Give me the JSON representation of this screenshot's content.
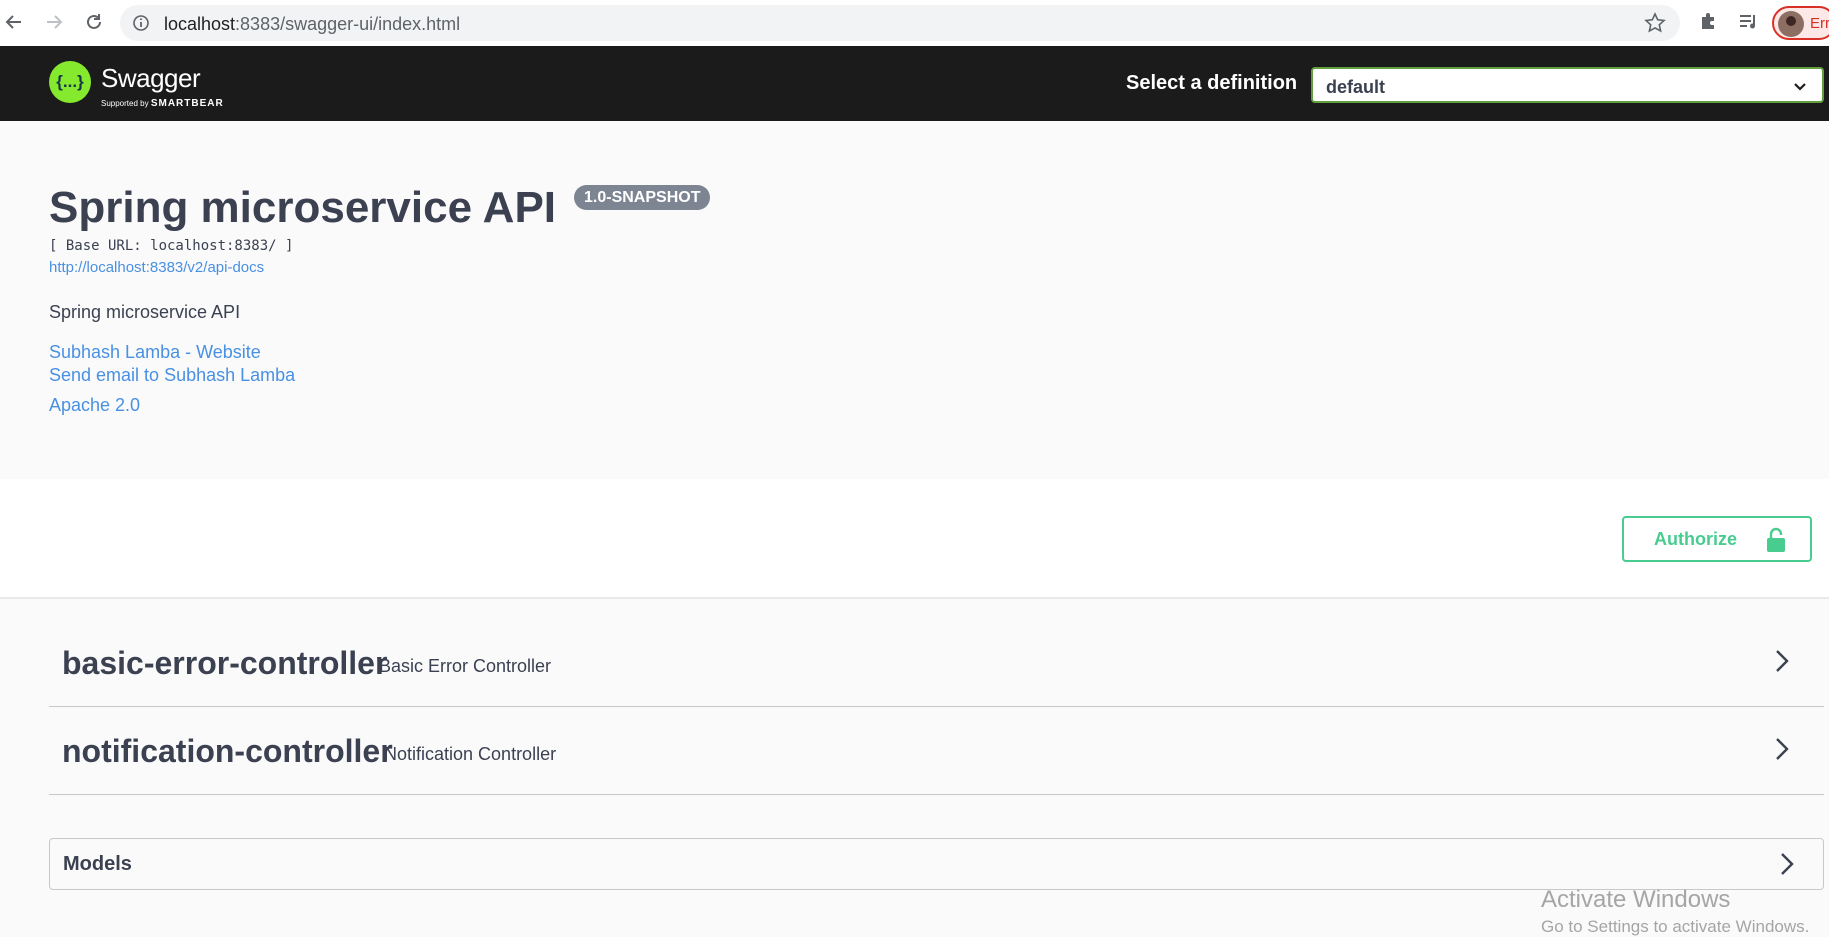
{
  "browser": {
    "url_host": "localhost",
    "url_rest": ":8383/swagger-ui/index.html",
    "profile_label": "Err"
  },
  "topbar": {
    "logo_symbol": "{...}",
    "logo_text": "Swagger",
    "logo_sub_prefix": "Supported by",
    "logo_sub_brand": "SMARTBEAR",
    "definition_label": "Select a definition",
    "definition_value": "default"
  },
  "info": {
    "title": "Spring microservice API",
    "version": "1.0-SNAPSHOT",
    "base_url": "[ Base URL: localhost:8383/ ]",
    "api_docs_link": "http://localhost:8383/v2/api-docs",
    "description": "Spring microservice API",
    "contact_website": "Subhash Lamba - Website",
    "contact_email": "Send email to Subhash Lamba",
    "license": "Apache 2.0"
  },
  "auth": {
    "button_label": "Authorize"
  },
  "tags": [
    {
      "name": "basic-error-controller",
      "description": "Basic Error Controller"
    },
    {
      "name": "notification-controller",
      "description": "Notification Controller"
    }
  ],
  "models": {
    "label": "Models"
  },
  "watermark": {
    "line1": "Activate Windows",
    "line2": "Go to Settings to activate Windows."
  },
  "colors": {
    "topbar_bg": "#1b1b1b",
    "swagger_green": "#85ea2d",
    "select_border": "#62a03f",
    "authorize_green": "#49cc90",
    "link_blue": "#4990e2",
    "badge_gray": "#7d8492",
    "text": "#3b4151"
  }
}
